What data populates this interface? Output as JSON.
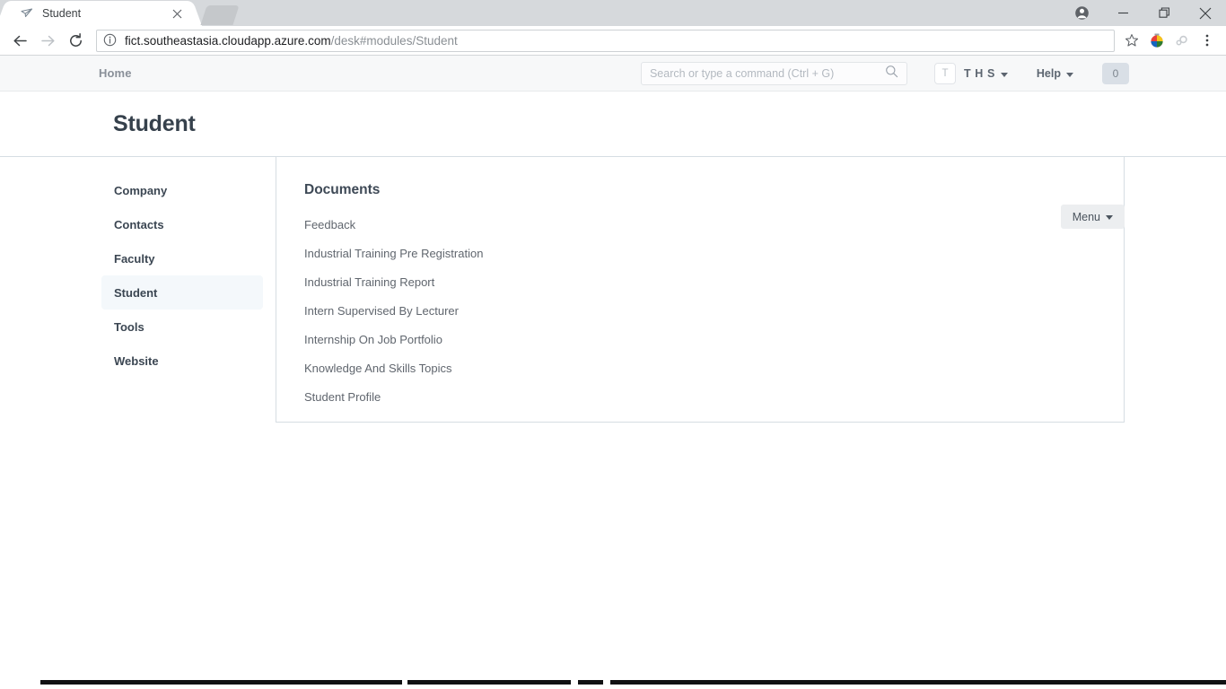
{
  "browser": {
    "tab": {
      "title": "Student",
      "favicon_icon": "paper-plane-icon",
      "close_icon": "close-icon"
    },
    "new_tab_icon": "new-tab-button",
    "window_controls": {
      "profile_icon": "profile-icon",
      "minimize_icon": "minimize-icon",
      "maximize_icon": "maximize-restore-icon",
      "close_icon": "window-close-icon"
    },
    "toolbar": {
      "back_icon": "back-arrow-icon",
      "forward_icon": "forward-arrow-icon",
      "reload_icon": "reload-icon",
      "info_icon": "site-info-icon",
      "url_domain": "fict.southeastasia.cloudapp.azure.com",
      "url_path": "/desk#modules/Student",
      "bookmark_icon": "star-icon",
      "extension_1_icon": "color-wheel-extension-icon",
      "extension_2_icon": "gear-extension-icon",
      "menu_icon": "three-dot-menu-icon"
    }
  },
  "navbar": {
    "home_label": "Home",
    "search": {
      "placeholder": "Search or type a command (Ctrl + G)",
      "value": "",
      "icon": "search-icon"
    },
    "avatar_initial": "T",
    "user_label": "T H S",
    "help_label": "Help",
    "badge_count": "0"
  },
  "header": {
    "title": "Student",
    "menu_label": "Menu"
  },
  "sidebar": {
    "items": [
      {
        "label": "Company",
        "active": false
      },
      {
        "label": "Contacts",
        "active": false
      },
      {
        "label": "Faculty",
        "active": false
      },
      {
        "label": "Student",
        "active": true
      },
      {
        "label": "Tools",
        "active": false
      },
      {
        "label": "Website",
        "active": false
      }
    ]
  },
  "main": {
    "section_heading": "Documents",
    "documents": [
      "Feedback",
      "Industrial Training Pre Registration",
      "Industrial Training Report",
      "Intern Supervised By Lecturer",
      "Internship On Job Portfolio",
      "Knowledge And Skills Topics",
      "Student Profile"
    ]
  },
  "colors": {
    "navbar_bg": "#f7f8f9",
    "active_item_bg": "#f4f8fb",
    "title_text": "#36414c",
    "border": "#d6dde3",
    "badge_bg": "#d9dfe6"
  }
}
